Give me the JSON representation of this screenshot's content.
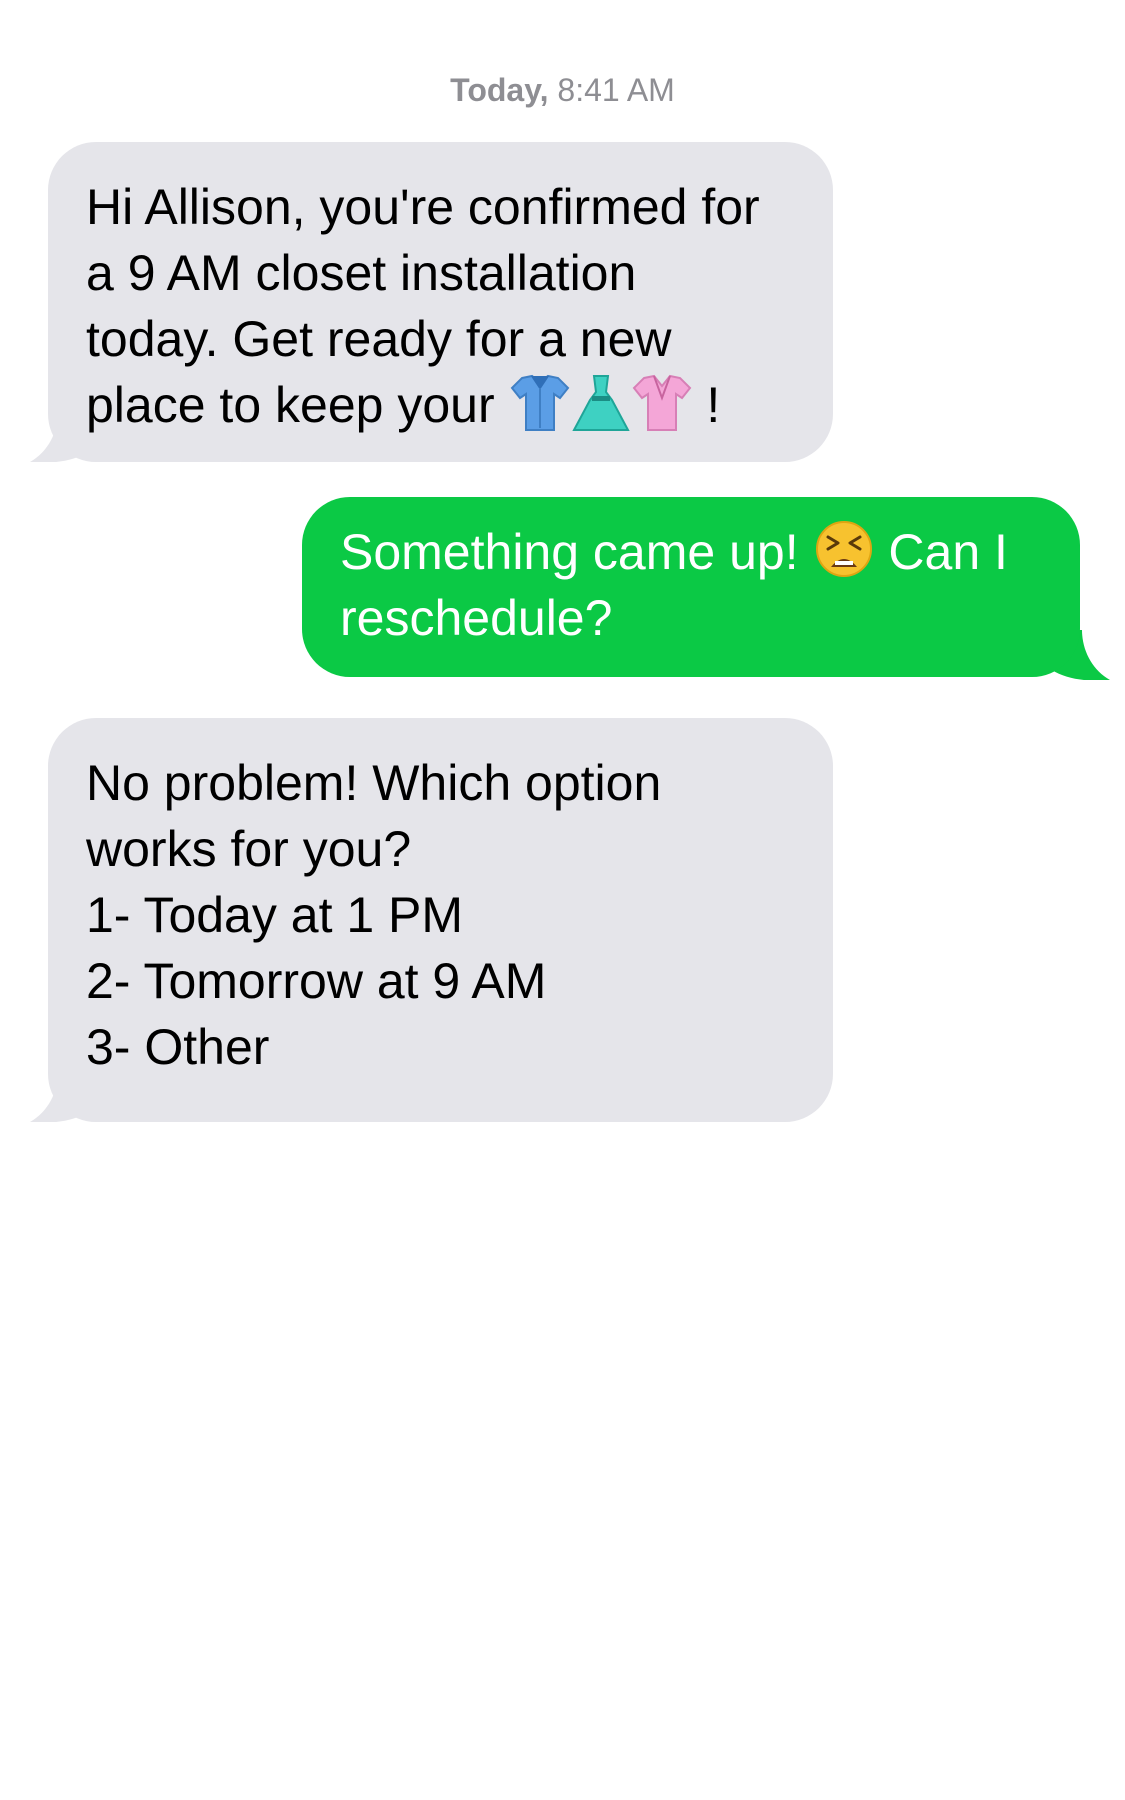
{
  "thread": {
    "timestamp_day": "Today,",
    "timestamp_time": "8:41 AM"
  },
  "colors": {
    "incoming_bubble": "#e5e5ea",
    "outgoing_bubble": "#0bc945",
    "timestamp": "#8e8e93"
  },
  "messages": [
    {
      "direction": "incoming",
      "lines": [
        "Hi Allison, you're confirmed for",
        "a 9 AM closet installation",
        "today. Get ready for a new",
        "place to keep your"
      ],
      "emojis": [
        "shirt-emoji",
        "dress-emoji",
        "blouse-emoji"
      ],
      "trailing": "!"
    },
    {
      "direction": "outgoing",
      "line1_before": "Something came up!",
      "emoji": "tired-face-emoji",
      "line1_after": "Can I",
      "line2": "reschedule?"
    },
    {
      "direction": "incoming",
      "lines": [
        "No problem! Which option",
        "works for you?",
        "1- Today at 1 PM",
        "2- Tomorrow at 9 AM",
        "3- Other"
      ]
    }
  ]
}
